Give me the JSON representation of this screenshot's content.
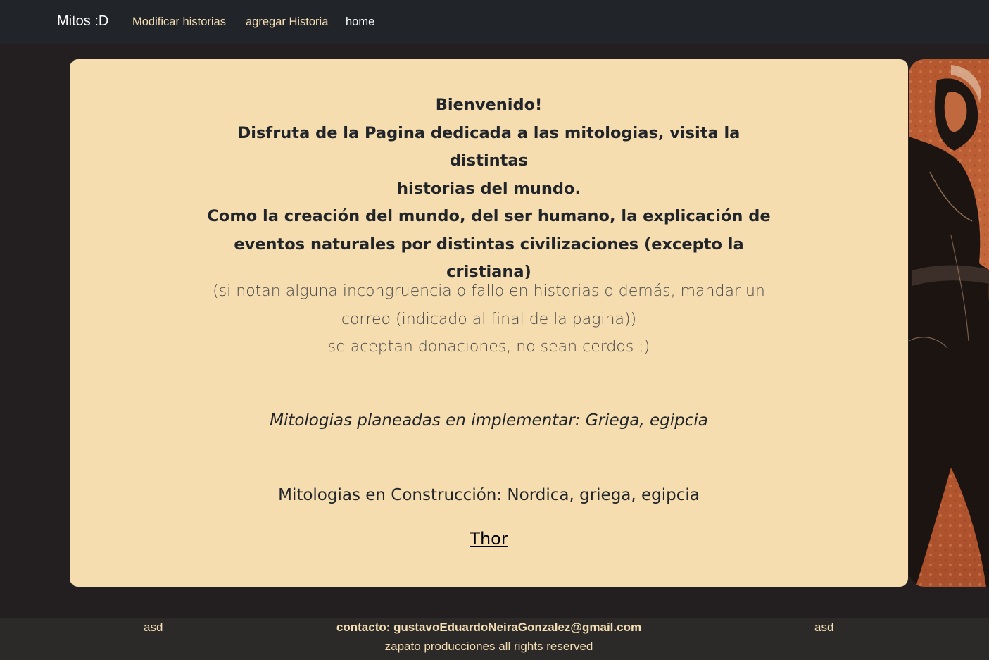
{
  "navbar": {
    "brand": "Mitos :D",
    "links": [
      {
        "label": "Modificar historias"
      },
      {
        "label": "agregar Historia"
      },
      {
        "label": "home"
      }
    ]
  },
  "card": {
    "welcome_lines": [
      "Bienvenido!",
      "Disfruta de la Pagina dedicada a las mitologias, visita la distintas",
      "historias del mundo.",
      "Como la creación del mundo, del ser humano, la explicación de",
      "eventos naturales por distintas civilizaciones (excepto la cristiana)"
    ],
    "note_lines": [
      "(si notan alguna incongruencia o fallo en historias o demás, mandar un",
      "correo (indicado al final de la pagina))",
      "se aceptan donaciones, no sean cerdos ;)"
    ],
    "planned": "Mitologias planeadas en implementar: Griega, egipcia",
    "construction": "Mitologias en Construcción: Nordica, griega, egipcia",
    "thor_link": "Thor"
  },
  "footer": {
    "left": "asd",
    "contact": "contacto: gustavoEduardoNeiraGonzalez@gmail.com",
    "right": "asd",
    "copyright": "zapato producciones all rights reserved"
  },
  "colors": {
    "navbar_bg": "#212529",
    "page_bg": "#231f20",
    "card_bg": "#f5ddb0",
    "link_color": "#f5deb3",
    "image_accent": "#b5572f"
  },
  "icons": [
    "greek-warrior-illustration"
  ]
}
